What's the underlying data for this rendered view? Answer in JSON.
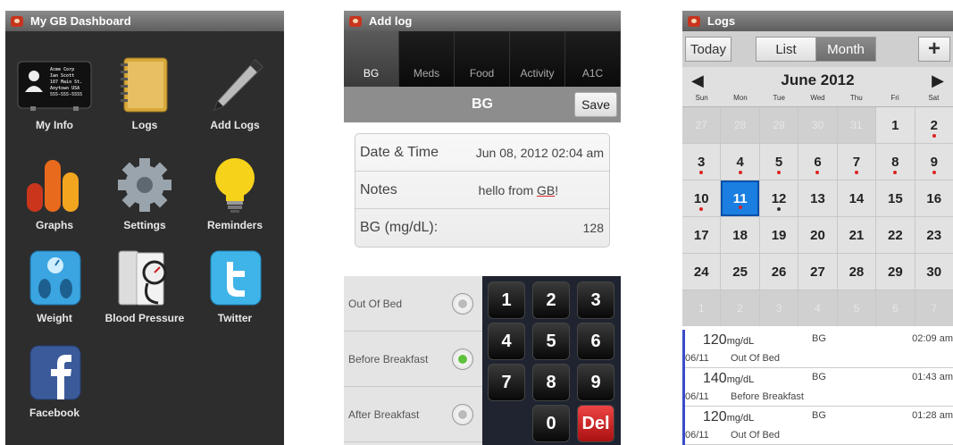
{
  "screen1": {
    "title": "My GB Dashboard",
    "tiles": [
      {
        "label": "My Info",
        "icon": "id-card-icon"
      },
      {
        "label": "Logs",
        "icon": "notebook-icon"
      },
      {
        "label": "Add Logs",
        "icon": "pen-icon"
      },
      {
        "label": "Graphs",
        "icon": "bar-graph-icon"
      },
      {
        "label": "Settings",
        "icon": "gear-icon"
      },
      {
        "label": "Reminders",
        "icon": "lightbulb-icon"
      },
      {
        "label": "Weight",
        "icon": "scale-icon"
      },
      {
        "label": "Blood Pressure",
        "icon": "blood-pressure-icon"
      },
      {
        "label": "Twitter",
        "icon": "twitter-icon"
      },
      {
        "label": "Facebook",
        "icon": "facebook-icon"
      }
    ],
    "card_text": [
      "Acme Corp",
      "Ian Scott",
      "107 Main St.",
      "Anytown USA",
      "555-555-5555"
    ]
  },
  "screen2": {
    "title": "Add log",
    "tabs": [
      "BG",
      "Meds",
      "Food",
      "Activity",
      "A1C"
    ],
    "active_tab": "BG",
    "section_title": "BG",
    "save_label": "Save",
    "rows": [
      {
        "label": "Date & Time",
        "value": "Jun 08, 2012 02:04 am"
      },
      {
        "label": "Notes",
        "value_before": "hello from ",
        "value_underlined": "GB",
        "value_after": "!"
      },
      {
        "label": "BG (mg/dL):",
        "value": "128"
      }
    ],
    "options": [
      {
        "label": "Out Of Bed",
        "selected": false
      },
      {
        "label": "Before Breakfast",
        "selected": true
      },
      {
        "label": "After Breakfast",
        "selected": false
      }
    ],
    "keys": [
      "1",
      "2",
      "3",
      "4",
      "5",
      "6",
      "7",
      "8",
      "9",
      "0",
      "Del"
    ]
  },
  "screen3": {
    "title": "Logs",
    "today_label": "Today",
    "list_label": "List",
    "month_label": "Month",
    "add_label": "+",
    "month_title": "June 2012",
    "weekdays": [
      "Sun",
      "Mon",
      "Tue",
      "Wed",
      "Thu",
      "Fri",
      "Sat"
    ],
    "days": [
      {
        "d": "27",
        "out": true
      },
      {
        "d": "28",
        "out": true
      },
      {
        "d": "29",
        "out": true
      },
      {
        "d": "30",
        "out": true
      },
      {
        "d": "31",
        "out": true
      },
      {
        "d": "1"
      },
      {
        "d": "2",
        "mark": "red"
      },
      {
        "d": "3",
        "mark": "red"
      },
      {
        "d": "4",
        "mark": "red"
      },
      {
        "d": "5",
        "mark": "red"
      },
      {
        "d": "6",
        "mark": "red"
      },
      {
        "d": "7",
        "mark": "red"
      },
      {
        "d": "8",
        "mark": "red"
      },
      {
        "d": "9",
        "mark": "red"
      },
      {
        "d": "10",
        "mark": "red"
      },
      {
        "d": "11",
        "mark": "red",
        "today": true
      },
      {
        "d": "12",
        "mark": "black"
      },
      {
        "d": "13"
      },
      {
        "d": "14"
      },
      {
        "d": "15"
      },
      {
        "d": "16"
      },
      {
        "d": "17"
      },
      {
        "d": "18"
      },
      {
        "d": "19"
      },
      {
        "d": "20"
      },
      {
        "d": "21"
      },
      {
        "d": "22"
      },
      {
        "d": "23"
      },
      {
        "d": "24"
      },
      {
        "d": "25"
      },
      {
        "d": "26"
      },
      {
        "d": "27"
      },
      {
        "d": "28"
      },
      {
        "d": "29"
      },
      {
        "d": "30"
      },
      {
        "d": "1",
        "out": true
      },
      {
        "d": "2",
        "out": true
      },
      {
        "d": "3",
        "out": true
      },
      {
        "d": "4",
        "out": true
      },
      {
        "d": "5",
        "out": true
      },
      {
        "d": "6",
        "out": true
      },
      {
        "d": "7",
        "out": true
      }
    ],
    "entries": [
      {
        "value": "120",
        "unit": "mg/dL",
        "type": "BG",
        "time": "02:09 am",
        "date": "06/11",
        "label": "Out Of Bed"
      },
      {
        "value": "140",
        "unit": "mg/dL",
        "type": "BG",
        "time": "01:43 am",
        "date": "06/11",
        "label": "Before Breakfast"
      },
      {
        "value": "120",
        "unit": "mg/dL",
        "type": "BG",
        "time": "01:28 am",
        "date": "06/11",
        "label": "Out Of Bed"
      }
    ]
  },
  "colors": {
    "accent": "#1a7fe0",
    "marker": "#d22",
    "selected_radio": "#5ec23c",
    "del_key": "#c22"
  }
}
